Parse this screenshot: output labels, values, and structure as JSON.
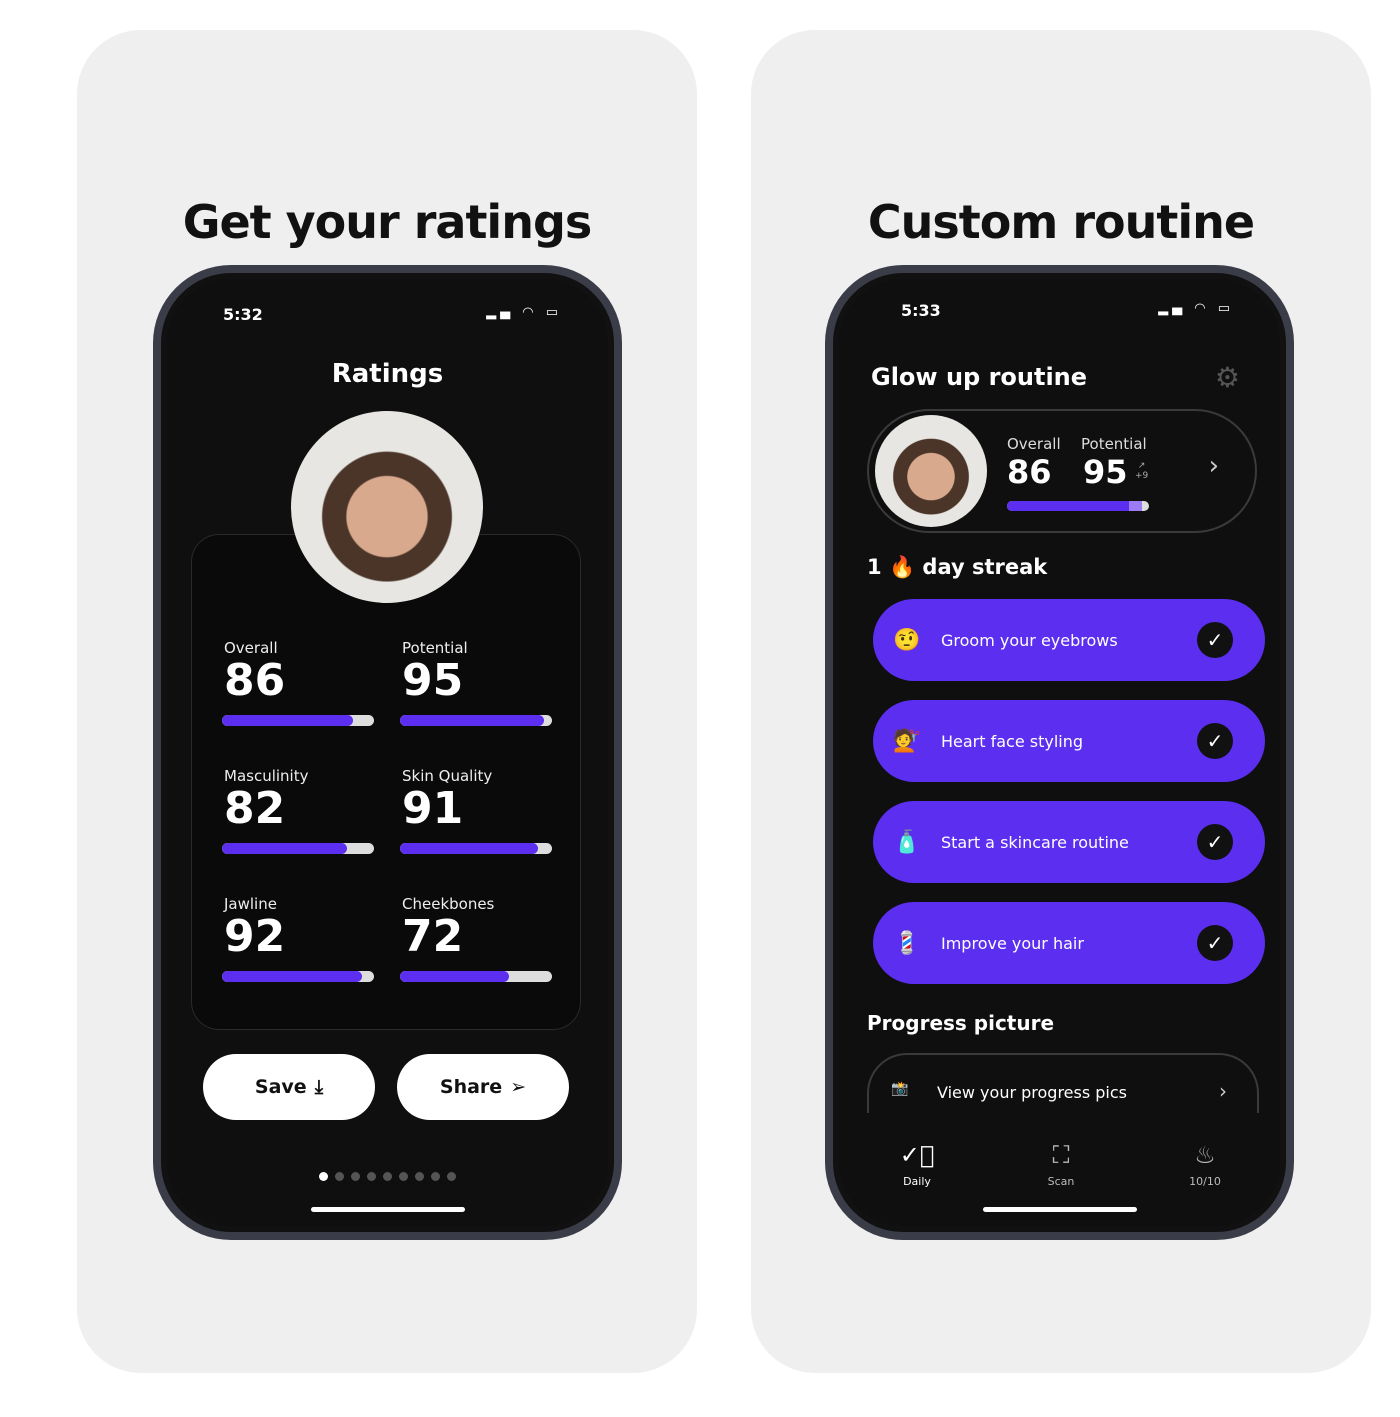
{
  "left": {
    "headline": "Get your ratings",
    "time": "5:32",
    "title": "Ratings",
    "ratings": [
      {
        "label": "Overall",
        "value": 86
      },
      {
        "label": "Potential",
        "value": 95
      },
      {
        "label": "Masculinity",
        "value": 82
      },
      {
        "label": "Skin Quality",
        "value": 91
      },
      {
        "label": "Jawline",
        "value": 92
      },
      {
        "label": "Cheekbones",
        "value": 72
      }
    ],
    "save": "Save",
    "share": "Share",
    "page_dots": 9,
    "active_dot": 1
  },
  "right": {
    "headline": "Custom routine",
    "time": "5:33",
    "title": "Glow up routine",
    "summary": {
      "overall_label": "Overall",
      "overall": "86",
      "potential_label": "Potential",
      "potential": "95",
      "delta": "+9",
      "overall_fraction": 0.86,
      "potential_fraction": 0.95
    },
    "streak_count": "1",
    "streak_label": "day streak",
    "tasks": [
      {
        "emoji": "🤨",
        "label": "Groom your eyebrows"
      },
      {
        "emoji": "💇",
        "label": "Heart face styling"
      },
      {
        "emoji": "🧴",
        "label": "Start a skincare routine"
      },
      {
        "emoji": "💈",
        "label": "Improve your hair"
      }
    ],
    "progress_title": "Progress picture",
    "progress_link": "View your progress pics",
    "nav": [
      {
        "icon": "check-circle-icon",
        "label": "Daily"
      },
      {
        "icon": "scan-icon",
        "label": "Scan"
      },
      {
        "icon": "flame-icon",
        "label": "10/10"
      }
    ]
  },
  "colors": {
    "accent": "#5b2ef0",
    "card_bg": "#efefef",
    "screen_bg": "#0f0f10"
  }
}
